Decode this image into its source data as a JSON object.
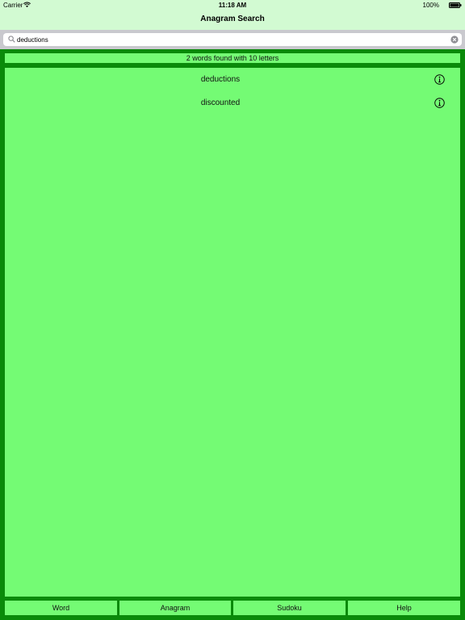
{
  "status_bar": {
    "carrier": "Carrier",
    "time": "11:18 AM",
    "battery": "100%",
    "icons": [
      "wifi-icon",
      "battery-icon"
    ]
  },
  "nav": {
    "title": "Anagram Search"
  },
  "search": {
    "value": "deductions",
    "icons": [
      "search-icon",
      "clear-icon"
    ]
  },
  "results": {
    "summary": "2 words found with 10 letters",
    "items": [
      {
        "word": "deductions",
        "icon": "info-icon"
      },
      {
        "word": "discounted",
        "icon": "info-icon"
      }
    ]
  },
  "tabs": [
    {
      "label": "Word"
    },
    {
      "label": "Anagram"
    },
    {
      "label": "Sudoku"
    },
    {
      "label": "Help"
    }
  ],
  "colors": {
    "frame": "#0a8a0a",
    "panel": "#74fb74",
    "header": "#d2fad2",
    "search_background": "#c9c9ce"
  }
}
